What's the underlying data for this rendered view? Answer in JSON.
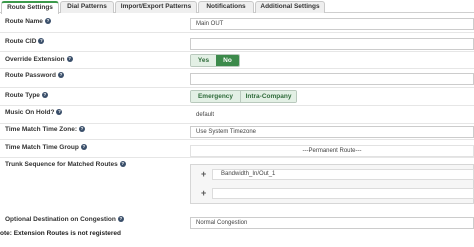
{
  "tabs": [
    {
      "label": "Route Settings",
      "active": true
    },
    {
      "label": "Dial Patterns",
      "active": false
    },
    {
      "label": "Import/Export Patterns",
      "active": false
    },
    {
      "label": "Notifications",
      "active": false
    },
    {
      "label": "Additional Settings",
      "active": false
    }
  ],
  "help_glyph": "?",
  "fields": {
    "route_name": {
      "label": "Route Name",
      "value": "Main OUT"
    },
    "route_cid": {
      "label": "Route CID",
      "value": ""
    },
    "override_extension": {
      "label": "Override Extension",
      "yes": "Yes",
      "no": "No",
      "selected": "No"
    },
    "route_password": {
      "label": "Route Password",
      "value": ""
    },
    "route_type": {
      "label": "Route Type",
      "options": [
        "Emergency",
        "Intra-Company"
      ]
    },
    "music_on_hold": {
      "label": "Music On Hold?",
      "value": "default"
    },
    "time_match_zone": {
      "label": "Time Match Time Zone:",
      "value": "Use System Timezone"
    },
    "time_match_group": {
      "label": "Time Match Time Group",
      "value": "---Permanent Route---"
    },
    "trunk_sequence": {
      "label": "Trunk Sequence for Matched Routes",
      "entries": [
        "Bandwidth_In/Out_1",
        ""
      ],
      "add_glyph": "+"
    },
    "optional_destination": {
      "label": "Optional Destination on Congestion",
      "value": "Normal Congestion"
    }
  },
  "note": "ote: Extension Routes is not registered",
  "colors": {
    "accent": "#3c8a4b",
    "help": "#3a4f6a"
  }
}
